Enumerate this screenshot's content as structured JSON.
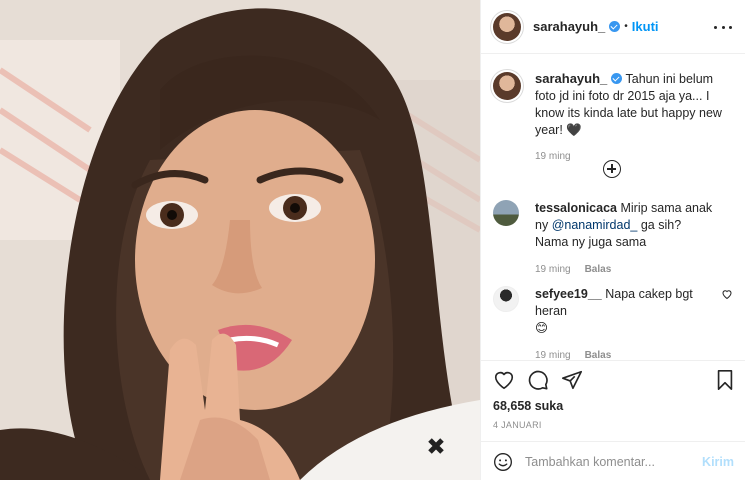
{
  "post": {
    "username": "sarahayuh_",
    "follow_label": "Ikuti",
    "dot": "•"
  },
  "caption": {
    "username": "sarahayuh_",
    "text": "Tahun ini belum foto jd ini foto dr 2015 aja ya... I know its kinda late but happy new year! 🖤",
    "time": "19 ming"
  },
  "comments": [
    {
      "username": "tessalonicaca",
      "text_before": "Mirip sama anak ny ",
      "mention": "@nanamirdad_",
      "text_after": " ga sih? Nama ny juga sama",
      "time": "19 ming",
      "reply": "Balas"
    },
    {
      "username": "sefyee19__",
      "text_before": "Napa cakep bgt heran ",
      "emoji_line": "😊",
      "time": "19 ming",
      "reply": "Balas"
    }
  ],
  "stats": {
    "likes": "68,658 suka",
    "date": "4 JANUARI"
  },
  "composer": {
    "placeholder": "Tambahkan komentar...",
    "send_label": "Kirim"
  },
  "icons": {
    "more": "more-options-icon",
    "load_more": "load-more-comments-icon",
    "like": "heart-icon",
    "comment": "comment-icon",
    "share": "share-icon",
    "save": "bookmark-icon",
    "emoji": "emoji-icon"
  },
  "colors": {
    "accent": "#0095f6",
    "verified": "#3897f0",
    "muted": "#8e8e8e",
    "send_disabled": "#b2dffc"
  }
}
